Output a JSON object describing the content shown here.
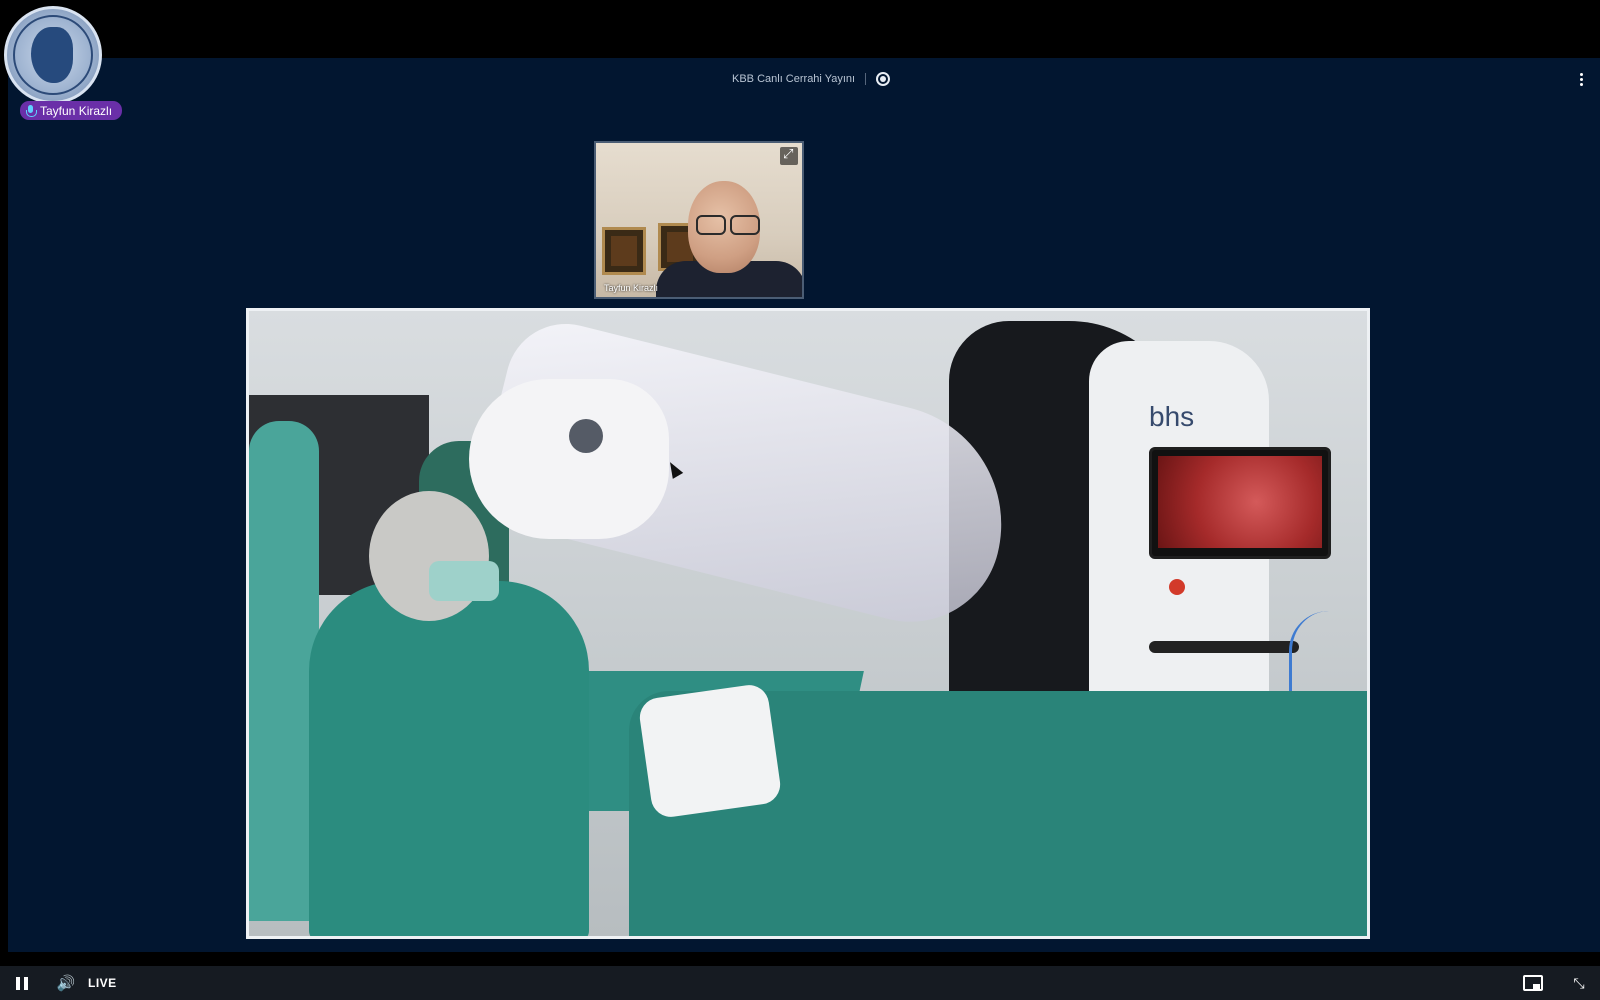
{
  "logo": {
    "text": "TÜRK KULAK BURUN BOĞAZ BAŞ BOYUN CERRAHİSİ DERNEĞİ 1928"
  },
  "speaker": {
    "name": "Tayfun Kirazlı",
    "mic_color": "#5fd0ff",
    "badge_color": "#6a2fa8"
  },
  "header": {
    "title": "KBB Canlı Cerrahi Yayını",
    "record_icon": "record-icon"
  },
  "presenter_tile": {
    "name": "Tayfun Kirazlı",
    "expand_icon": "expand-icon"
  },
  "main_video": {
    "brand_text": "bhs"
  },
  "controls": {
    "live_label": "LIVE",
    "icons": [
      "pause-icon",
      "volume-icon",
      "pip-icon",
      "exit-fullscreen-icon"
    ]
  },
  "colors": {
    "stage_background": "#021630",
    "control_bar": "#161b22"
  }
}
